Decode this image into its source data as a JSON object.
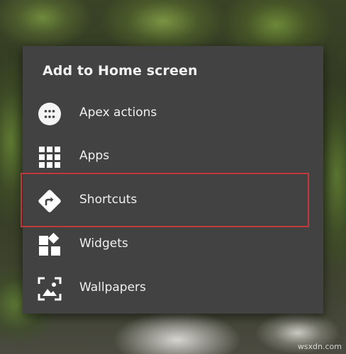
{
  "dialog": {
    "title": "Add to Home screen",
    "items": [
      {
        "label": "Apex actions",
        "icon": "apex-actions-icon"
      },
      {
        "label": "Apps",
        "icon": "apps-grid-icon"
      },
      {
        "label": "Shortcuts",
        "icon": "shortcuts-icon"
      },
      {
        "label": "Widgets",
        "icon": "widgets-icon"
      },
      {
        "label": "Wallpapers",
        "icon": "wallpapers-icon"
      }
    ]
  },
  "highlight": {
    "target": "Shortcuts",
    "color": "#c0393b"
  },
  "colors": {
    "dialog_background": "#424242",
    "text": "#f0f0f0",
    "icon": "#ffffff"
  },
  "watermark": "wsxdn.com"
}
